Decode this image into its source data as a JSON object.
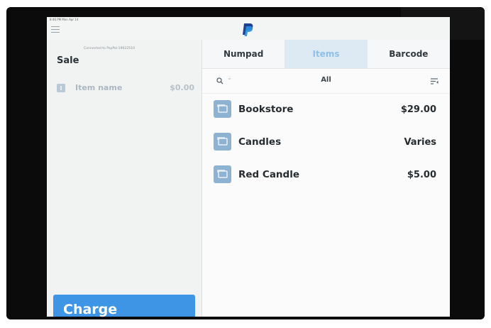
{
  "status_bar": {
    "text": "8:46 PM  Mon Apr 14"
  },
  "header": {
    "logo_icon": "paypal-logo"
  },
  "left_panel": {
    "connection_status": "Connected to PayPal-19022510",
    "title": "Sale",
    "line_item": {
      "name": "Item name",
      "price": "$0.00"
    },
    "charge_label": "Charge"
  },
  "tabs": [
    {
      "label": "Numpad",
      "active": false
    },
    {
      "label": "Items",
      "active": true
    },
    {
      "label": "Barcode",
      "active": false
    }
  ],
  "filter": {
    "category": "All",
    "search_icon": "search-icon",
    "sort_icon": "sort-icon"
  },
  "items": [
    {
      "name": "Bookstore",
      "price": "$29.00"
    },
    {
      "name": "Candles",
      "price": "Varies"
    },
    {
      "name": "Red Candle",
      "price": "$5.00"
    }
  ],
  "colors": {
    "accent": "#3e95e6",
    "active_tab_bg": "#dde9f3",
    "thumb": "#8eb3d2"
  }
}
